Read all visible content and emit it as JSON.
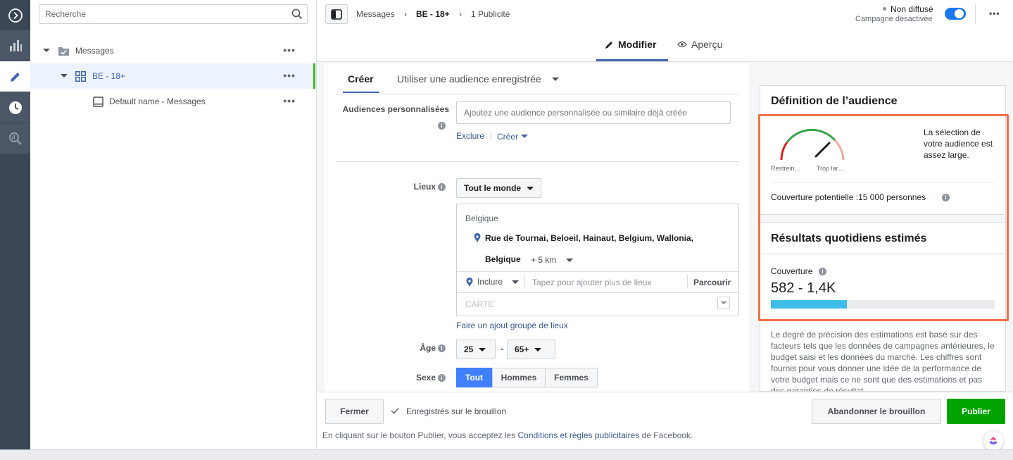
{
  "tree": {
    "search_placeholder": "Recherche",
    "items": [
      {
        "label": "Messages"
      },
      {
        "label": "BE - 18+"
      },
      {
        "label": "Default name - Messages"
      }
    ],
    "more_glyph": "•••"
  },
  "topbar": {
    "breadcrumb": [
      "Messages",
      "BE - 18+",
      "1 Publicité"
    ],
    "status_title": "Non diffusé",
    "status_sub": "Campagne désactivée",
    "more_glyph": "•••"
  },
  "tabs": {
    "edit": "Modifier",
    "preview": "Aperçu"
  },
  "form": {
    "subtabs": {
      "create": "Créer",
      "saved": "Utiliser une audience enregistrée"
    },
    "custom_audiences": {
      "label": "Audiences personnalisées",
      "placeholder": "Ajoutez une audience personnalisée ou similaire déjà créée",
      "exclude": "Exclure",
      "create": "Créer"
    },
    "locations": {
      "label": "Lieux",
      "dropdown": "Tout le monde",
      "country": "Belgique",
      "address_line1": "Rue de Tournai, Beloeil, Hainaut, Belgium, Wallonia,",
      "address_line2": "Belgique",
      "radius": "+ 5 km",
      "include": "Inclure",
      "add_placeholder": "Tapez pour ajouter plus de lieux",
      "browse": "Parcourir",
      "map": "CARTE",
      "bulk_link": "Faire un ajout groupé de lieux"
    },
    "age": {
      "label": "Âge",
      "min": "25",
      "separator": "-",
      "max": "65+"
    },
    "gender": {
      "label": "Sexe",
      "options": [
        "Tout",
        "Hommes",
        "Femmes"
      ]
    }
  },
  "audience": {
    "title": "Définition de l’audience",
    "gauge_left": "Restrein…",
    "gauge_right": "Trop lar…",
    "gauge_text": "La sélection de votre audience est assez large.",
    "potential_reach": "Couverture potentielle :15 000 personnes",
    "results_title": "Résultats quotidiens estimés",
    "reach_label": "Couverture",
    "reach_value": "582 - 1,4K",
    "reach_bar_fraction": 0.34,
    "disclaimer": "Le degré de précision des estimations est basé sur des facteurs tels que les données de campagnes antérieures, le budget saisi et les données du marché. Les chiffres sont fournis pour vous donner une idée de la performance de votre budget mais ce ne sont que des estimations et pas des garanties de résultat."
  },
  "footer": {
    "close": "Fermer",
    "saved": "Enregistrés sur le brouillon",
    "discard": "Abandonner le brouillon",
    "publish": "Publier",
    "terms_prefix": "En cliquant sur le bouton Publier, vous acceptez les ",
    "terms_link": "Conditions et règles publicitaires",
    "terms_suffix": " de Facebook."
  },
  "colors": {
    "rail": "#3a4656",
    "accent_blue": "#4267b2",
    "publish_green": "#42b72a",
    "highlight": "#f27046",
    "bar_fill": "#3ebde8"
  }
}
